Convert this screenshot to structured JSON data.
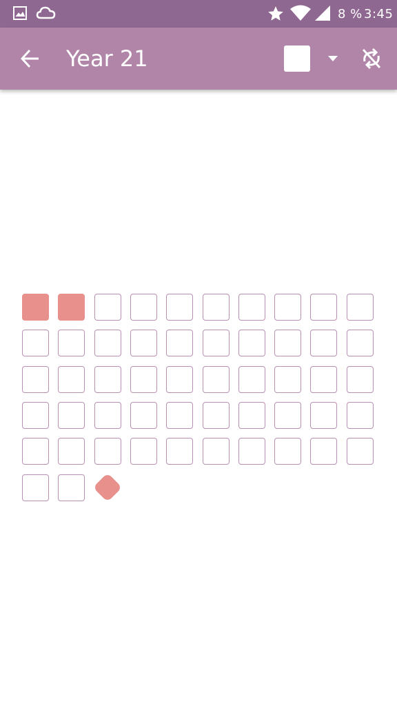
{
  "status_bar": {
    "battery": "8 %",
    "time": "3:45",
    "icons": [
      "image-icon",
      "cloud-icon",
      "star-icon",
      "wifi-icon",
      "signal-icon"
    ]
  },
  "app_bar": {
    "title": "Year 21",
    "back_icon": "arrow-left-icon",
    "color_swatch": "#ffffff",
    "dropdown_icon": "caret-down-icon",
    "sync_icon": "sync-disabled-icon"
  },
  "grid": {
    "columns": 10,
    "total": 52,
    "filled": [
      0,
      1
    ],
    "current": 52,
    "filled_color": "#e8908b",
    "outline_color": "#b98fb3"
  },
  "colors": {
    "status_bar": "#8f6891",
    "app_bar": "#b085a8"
  }
}
